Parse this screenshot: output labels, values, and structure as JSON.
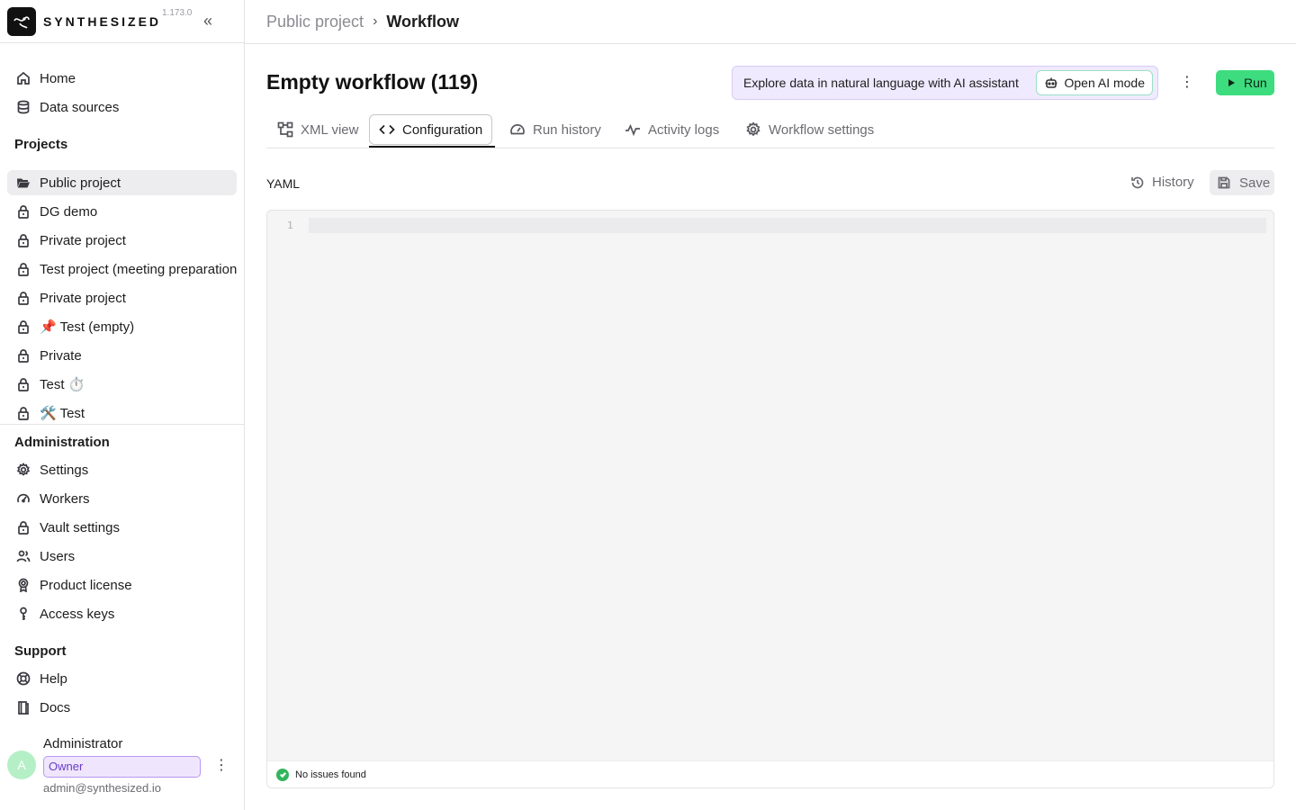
{
  "brand": {
    "name": "SYNTHESIZED",
    "version": "1.173.0"
  },
  "nav": {
    "home": "Home",
    "data_sources": "Data sources"
  },
  "projects": {
    "title": "Projects",
    "items": [
      {
        "label": "Public project",
        "icon": "folder-open-icon",
        "active": true
      },
      {
        "label": "DG demo",
        "icon": "lock-icon"
      },
      {
        "label": "Test project (meeting preparation)",
        "icon": "lock-icon"
      },
      {
        "label": "Private project",
        "icon": "lock-icon"
      },
      {
        "label": "📌 Test (empty)",
        "icon": "lock-icon"
      },
      {
        "label": "Private",
        "icon": "lock-icon"
      },
      {
        "label": "Test ⏱️",
        "icon": "lock-icon"
      },
      {
        "label": "🛠️ Test",
        "icon": "lock-icon"
      }
    ]
  },
  "administration": {
    "title": "Administration",
    "items": [
      "Settings",
      "Workers",
      "Vault settings",
      "Users",
      "Product license",
      "Access keys"
    ]
  },
  "support": {
    "title": "Support",
    "items": [
      "Help",
      "Docs"
    ]
  },
  "user": {
    "initial": "A",
    "name": "Administrator",
    "role": "Owner",
    "email": "admin@synthesized.io"
  },
  "breadcrumb": {
    "parent": "Public project",
    "current": "Workflow"
  },
  "page": {
    "title": "Empty workflow (119)",
    "ai_banner_text": "Explore data in natural language with AI assistant",
    "ai_button": "Open AI mode",
    "run_button": "Run"
  },
  "tabs": [
    "XML view",
    "Configuration",
    "Run history",
    "Activity logs",
    "Workflow settings"
  ],
  "active_tab": "Configuration",
  "editor": {
    "label": "YAML",
    "history_button": "History",
    "save_button": "Save",
    "line_number": "1",
    "status": "No issues found"
  },
  "colors": {
    "run_button": "#3ddc7f",
    "owner_badge": "#efe6fd",
    "ai_banner": "#efeafd",
    "status_ok": "#32b65d"
  }
}
